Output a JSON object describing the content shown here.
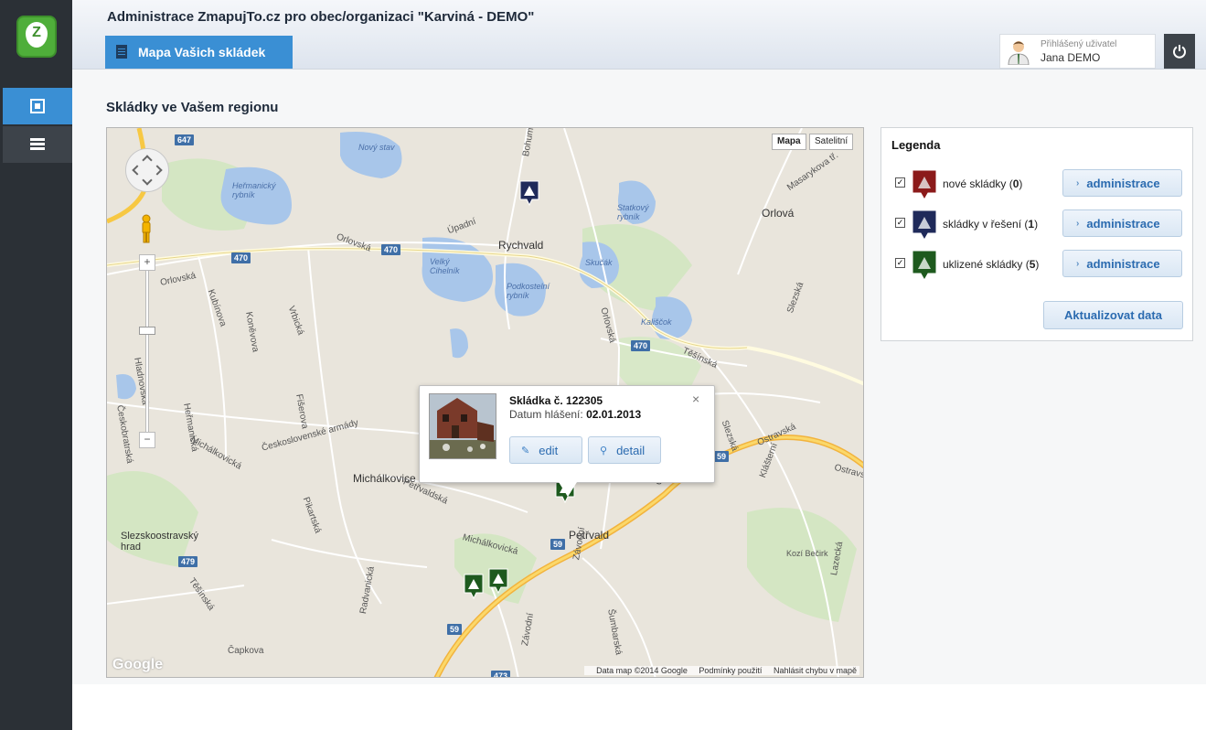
{
  "header": {
    "title": "Administrace ZmapujTo.cz pro obec/organizaci \"Karviná - DEMO\"",
    "map_tab_label": "Mapa Vašich skládek",
    "user_label": "Přihlášený uživatel",
    "user_name": "Jana DEMO"
  },
  "sidebar": {
    "logo_letter": "Z",
    "items": [
      {
        "icon": "dashboard-icon",
        "active": true
      },
      {
        "icon": "list-icon",
        "active": false
      }
    ]
  },
  "main": {
    "section_title": "Skládky ve Vašem regionu"
  },
  "map": {
    "type_buttons": [
      "Mapa",
      "Satelitní"
    ],
    "active_type": "Mapa",
    "zoom_in": "+",
    "zoom_out": "−",
    "labels": {
      "novy_stav": "Nový stav",
      "hermanicky": "Heřmanický rybník",
      "bohuminska": "Bohumínská",
      "masarykova": "Masarykova tř.",
      "orlova_town": "Orlová",
      "statkovy": "Statkový rybník",
      "rychvald": "Rychvald",
      "upadni": "Úpadní",
      "orlovska1": "Orlovská",
      "orlovska2": "Orlovská",
      "velky_cihelnik": "Velký Cihelník",
      "skucak": "Skučák",
      "podkostelni": "Podkostelní rybník",
      "kubinova": "Kubínova",
      "konevova": "Koněvova",
      "vrbicka": "Vrbická",
      "hladnovska": "Hladnovská",
      "kaliscok": "Kališčok",
      "orlovska3": "Orlovská",
      "slezska1": "Slezská",
      "tesinska1": "Těšínská",
      "hermanicka": "Heřmanická",
      "fisirova": "Fišerova",
      "ceskobratrska": "Českobratrská",
      "michalkovicka1": "Michálkovická",
      "ceskoslovenske": "Československé armády",
      "slezska2": "Slezská",
      "ostravska": "Ostravská",
      "klasterni": "Klášterní",
      "ostravs": "Ostravs",
      "michalkovice": "Michálkovice",
      "petrvaldska": "Petřvaldská",
      "pikartska": "Pikartská",
      "slezskoostravsky": "Slezskoostravský hrad",
      "petrvald": "Petřvald",
      "michalkovicka2": "Michálkovická",
      "tesinska2": "Těšínská",
      "zavodni1": "Závodní",
      "kozi_becirk": "Kozí Bečirk",
      "lazecka": "Lazecká",
      "radvanicka": "Radvanická",
      "zavodni2": "Závodní",
      "sumbarska": "Šumbarská",
      "capkova": "Čapkova",
      "ostr": "Ostr"
    },
    "road_badges": [
      "647",
      "470",
      "470",
      "470",
      "59",
      "59",
      "479",
      "59",
      "473"
    ],
    "footer": [
      "Data map ©2014 Google",
      "Podmínky použití",
      "Nahlásit chybu v mapě"
    ],
    "google_logo": "Google",
    "popup": {
      "title": "Skládka č. 122305",
      "date_label": "Datum hlášení:",
      "date_value": "02.01.2013",
      "edit_label": "edit",
      "detail_label": "detail",
      "close": "×"
    }
  },
  "legend": {
    "title": "Legenda",
    "rows": [
      {
        "label": "nové skládky",
        "count": "0",
        "color": "#8b1a1a",
        "button": "administrace",
        "checked": true
      },
      {
        "label": "skládky v řešení",
        "count": "1",
        "color": "#1f2a5a",
        "button": "administrace",
        "checked": true
      },
      {
        "label": "uklizené skládky",
        "count": "5",
        "color": "#1e5a1e",
        "button": "administrace",
        "checked": true
      }
    ],
    "refresh_button": "Aktualizovat data"
  },
  "colors": {
    "accent": "#3a8fd4",
    "sidebar": "#2b3036",
    "new": "#8b1a1a",
    "in_progress": "#1f2a5a",
    "cleaned": "#1e5a1e"
  }
}
